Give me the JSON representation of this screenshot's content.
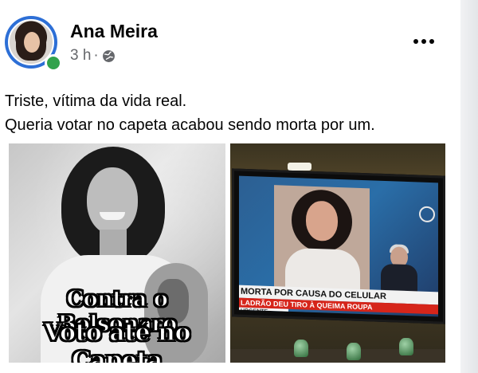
{
  "post": {
    "author": "Ana Meira",
    "time": "3 h",
    "separator": "·",
    "privacy_icon": "globe-icon",
    "more_icon": "more-horizontal-icon",
    "text_lines": [
      "Triste, vítima da vida real.",
      "Queria votar no capeta acabou sendo morta por um."
    ]
  },
  "images": {
    "left": {
      "caption_lines": [
        "Contra o Bolsonaro",
        "Voto até no Capeta"
      ]
    },
    "right": {
      "ticker_main": "MORTA POR CAUSA DO CELULAR",
      "ticker_sub": "LADRÃO DEU TIRO À QUEIMA ROUPA",
      "ticker_tag": "URGENTE"
    }
  },
  "colors": {
    "online": "#31a24c",
    "avatar_ring": "#2d6fd6",
    "ticker_red": "#d6251a"
  }
}
